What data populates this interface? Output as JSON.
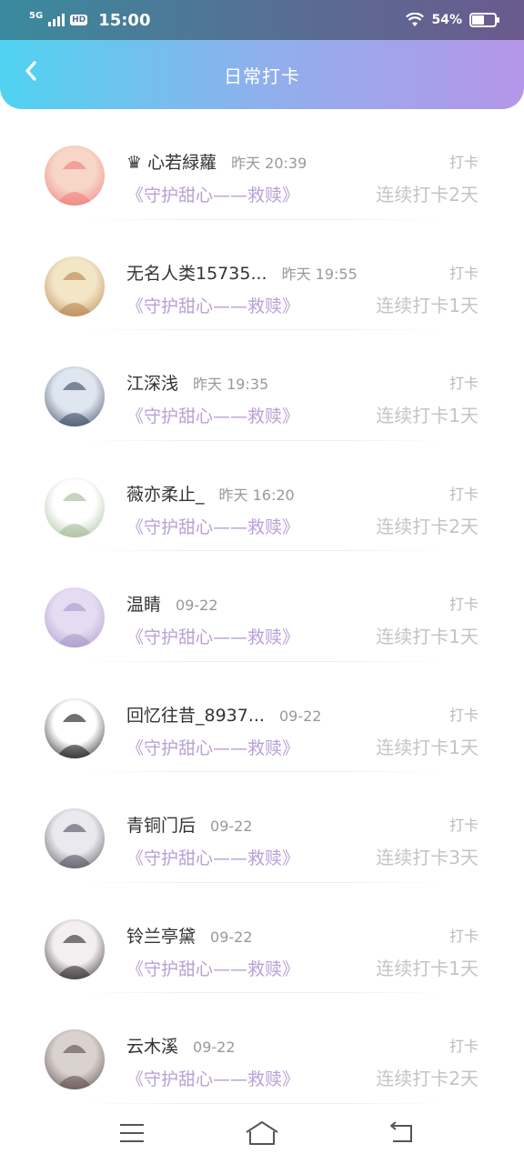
{
  "status_bar": {
    "network": "5G",
    "hd": "HD",
    "time": "15:00",
    "battery_percent": "54%",
    "battery_level": 0.54
  },
  "header": {
    "title": "日常打卡",
    "back_icon": "chevron-left-icon"
  },
  "checkins": [
    {
      "name": "♛ 心若緑蘿",
      "time": "昨天 20:39",
      "book": "《守护甜心——救赎》",
      "action": "打卡",
      "streak": "连续打卡2天",
      "avatar_colors": [
        "#f7d6c8",
        "#f07c7c"
      ]
    },
    {
      "name": "无名人类15735...",
      "time": "昨天 19:55",
      "book": "《守护甜心——救赎》",
      "action": "打卡",
      "streak": "连续打卡1天",
      "avatar_colors": [
        "#f3e6c7",
        "#b6824e"
      ]
    },
    {
      "name": "江深浅",
      "time": "昨天 19:35",
      "book": "《守护甜心——救赎》",
      "action": "打卡",
      "streak": "连续打卡1天",
      "avatar_colors": [
        "#dfe6ef",
        "#3a4660"
      ]
    },
    {
      "name": "薇亦柔止_",
      "time": "昨天 16:20",
      "book": "《守护甜心——救赎》",
      "action": "打卡",
      "streak": "连续打卡2天",
      "avatar_colors": [
        "#ffffff",
        "#9fb894"
      ]
    },
    {
      "name": "温睛",
      "time": "09-22",
      "book": "《守护甜心——救赎》",
      "action": "打卡",
      "streak": "连续打卡1天",
      "avatar_colors": [
        "#e6dcf2",
        "#a796c9"
      ]
    },
    {
      "name": "回忆往昔_8937...",
      "time": "09-22",
      "book": "《守护甜心——救赎》",
      "action": "打卡",
      "streak": "连续打卡1天",
      "avatar_colors": [
        "#ffffff",
        "#111111"
      ]
    },
    {
      "name": "青铜门后",
      "time": "09-22",
      "book": "《守护甜心——救赎》",
      "action": "打卡",
      "streak": "连续打卡3天",
      "avatar_colors": [
        "#e9e9ee",
        "#50505c"
      ]
    },
    {
      "name": "铃兰亭黛",
      "time": "09-22",
      "book": "《守护甜心——救赎》",
      "action": "打卡",
      "streak": "连续打卡1天",
      "avatar_colors": [
        "#f3eef0",
        "#2a2328"
      ]
    },
    {
      "name": "云木溪",
      "time": "09-22",
      "book": "《守护甜心——救赎》",
      "action": "打卡",
      "streak": "连续打卡2天",
      "avatar_colors": [
        "#d9d2cf",
        "#5b4a47"
      ]
    }
  ],
  "nav": {
    "menu_icon": "menu-icon",
    "home_icon": "home-icon",
    "back_icon": "return-icon"
  }
}
